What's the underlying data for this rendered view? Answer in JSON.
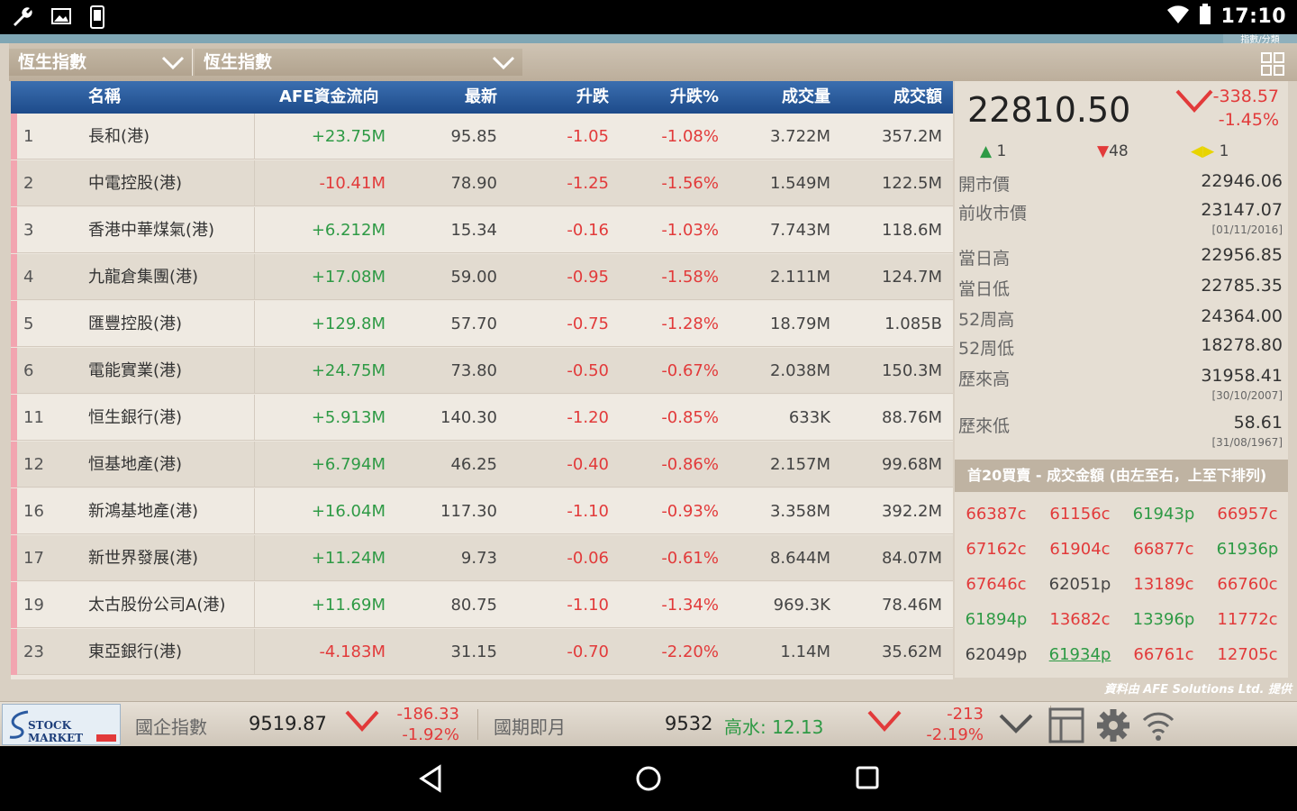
{
  "status": {
    "time": "17:10"
  },
  "selectors": {
    "market": "恆生指數",
    "index": "恆生指數",
    "tag": "指數/分類"
  },
  "table": {
    "headers": [
      "名稱",
      "AFE資金流向",
      "最新",
      "升跌",
      "升跌%",
      "成交量",
      "成交額"
    ],
    "rows": [
      {
        "code": "1",
        "name": "長和(港)",
        "flow": "+23.75M",
        "last": "95.85",
        "chg": "-1.05",
        "pct": "-1.08%",
        "vol": "3.722M",
        "amt": "357.2M"
      },
      {
        "code": "2",
        "name": "中電控股(港)",
        "flow": "-10.41M",
        "last": "78.90",
        "chg": "-1.25",
        "pct": "-1.56%",
        "vol": "1.549M",
        "amt": "122.5M"
      },
      {
        "code": "3",
        "name": "香港中華煤氣(港)",
        "flow": "+6.212M",
        "last": "15.34",
        "chg": "-0.16",
        "pct": "-1.03%",
        "vol": "7.743M",
        "amt": "118.6M"
      },
      {
        "code": "4",
        "name": "九龍倉集團(港)",
        "flow": "+17.08M",
        "last": "59.00",
        "chg": "-0.95",
        "pct": "-1.58%",
        "vol": "2.111M",
        "amt": "124.7M"
      },
      {
        "code": "5",
        "name": "匯豐控股(港)",
        "flow": "+129.8M",
        "last": "57.70",
        "chg": "-0.75",
        "pct": "-1.28%",
        "vol": "18.79M",
        "amt": "1.085B"
      },
      {
        "code": "6",
        "name": "電能實業(港)",
        "flow": "+24.75M",
        "last": "73.80",
        "chg": "-0.50",
        "pct": "-0.67%",
        "vol": "2.038M",
        "amt": "150.3M"
      },
      {
        "code": "11",
        "name": "恒生銀行(港)",
        "flow": "+5.913M",
        "last": "140.30",
        "chg": "-1.20",
        "pct": "-0.85%",
        "vol": "633K",
        "amt": "88.76M"
      },
      {
        "code": "12",
        "name": "恒基地產(港)",
        "flow": "+6.794M",
        "last": "46.25",
        "chg": "-0.40",
        "pct": "-0.86%",
        "vol": "2.157M",
        "amt": "99.68M"
      },
      {
        "code": "16",
        "name": "新鴻基地產(港)",
        "flow": "+16.04M",
        "last": "117.30",
        "chg": "-1.10",
        "pct": "-0.93%",
        "vol": "3.358M",
        "amt": "392.2M"
      },
      {
        "code": "17",
        "name": "新世界發展(港)",
        "flow": "+11.24M",
        "last": "9.73",
        "chg": "-0.06",
        "pct": "-0.61%",
        "vol": "8.644M",
        "amt": "84.07M"
      },
      {
        "code": "19",
        "name": "太古股份公司A(港)",
        "flow": "+11.69M",
        "last": "80.75",
        "chg": "-1.10",
        "pct": "-1.34%",
        "vol": "969.3K",
        "amt": "78.46M"
      },
      {
        "code": "23",
        "name": "東亞銀行(港)",
        "flow": "-4.183M",
        "last": "31.15",
        "chg": "-0.70",
        "pct": "-2.20%",
        "vol": "1.14M",
        "amt": "35.62M"
      }
    ]
  },
  "panel": {
    "index_value": "22810.50",
    "change": "-338.57",
    "change_pct": "-1.45%",
    "up": "1",
    "down": "48",
    "flat": "1",
    "stats": [
      {
        "label": "開市價",
        "value": "22946.06",
        "date": ""
      },
      {
        "label": "前收市價",
        "value": "23147.07",
        "date": "[01/11/2016]"
      },
      {
        "label": "當日高",
        "value": "22956.85",
        "date": ""
      },
      {
        "label": "當日低",
        "value": "22785.35",
        "date": ""
      },
      {
        "label": "52周高",
        "value": "24364.00",
        "date": ""
      },
      {
        "label": "52周低",
        "value": "18278.80",
        "date": ""
      },
      {
        "label": "歷來高",
        "value": "31958.41",
        "date": "[30/10/2007]"
      },
      {
        "label": "歷來低",
        "value": "58.61",
        "date": "[31/08/1967]"
      }
    ],
    "top20_title": "首20買賣 - 成交金額 (由左至右，上至下排列)",
    "brokers": [
      [
        "66387c",
        "61156c",
        "61943p",
        "66957c"
      ],
      [
        "67162c",
        "61904c",
        "66877c",
        "61936p"
      ],
      [
        "67646c",
        "62051p",
        "13189c",
        "66760c"
      ],
      [
        "61894p",
        "13682c",
        "13396p",
        "11772c"
      ],
      [
        "62049p",
        "61934p",
        "66761c",
        "12705c"
      ]
    ],
    "credit": "資料由 AFE Solutions Ltd. 提供"
  },
  "bottom": {
    "logo_text": "STOCK MARKET",
    "hsce_label": "國企指數",
    "hsce_value": "9519.87",
    "hsce_change": "-186.33",
    "hsce_pct": "-1.92%",
    "futures_label": "國期即月",
    "futures_value": "9532",
    "futures_premium": "高水: 12.13",
    "futures_change": "-213",
    "futures_pct": "-2.19%"
  }
}
